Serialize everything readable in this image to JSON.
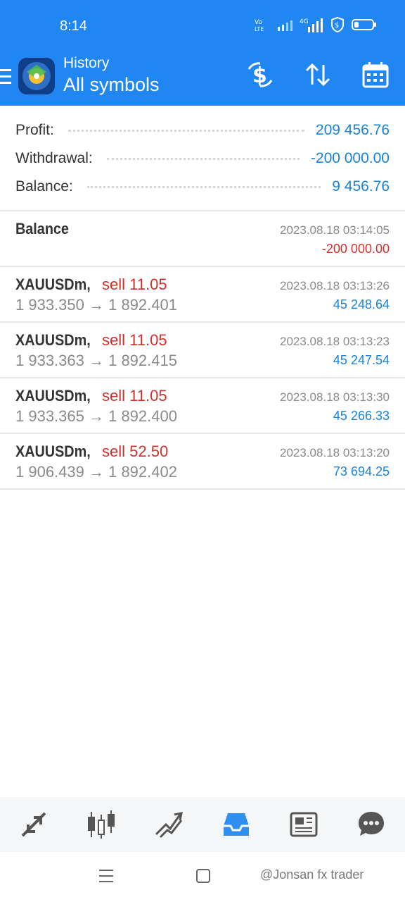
{
  "status_bar": {
    "time": "8:14",
    "battery": 0.25
  },
  "header": {
    "subtitle": "History",
    "title": "All symbols"
  },
  "summary": [
    {
      "label": "Profit:",
      "value": "209 456.76"
    },
    {
      "label": "Withdrawal:",
      "value": "-200 000.00"
    },
    {
      "label": "Balance:",
      "value": "9 456.76"
    }
  ],
  "trades": [
    {
      "title": "Balance",
      "time": "2023.08.18 03:14:05",
      "amount": "-200 000.00",
      "amount_color": "#d0302d"
    },
    {
      "symbol": "XAUUSDm,",
      "action": "sell 11.05",
      "prices": "1 933.350 → 1 892.401",
      "time": "2023.08.18 03:13:26",
      "amount": "45 248.64"
    },
    {
      "symbol": "XAUUSDm,",
      "action": "sell 11.05",
      "prices": "1 933.363 → 1 892.415",
      "time": "2023.08.18 03:13:23",
      "amount": "45 247.54"
    },
    {
      "symbol": "XAUUSDm,",
      "action": "sell 11.05",
      "prices": "1 933.365 → 1 892.400",
      "time": "2023.08.18 03:13:30",
      "amount": "45 266.33"
    },
    {
      "symbol": "XAUUSDm,",
      "action": "sell 52.50",
      "prices": "1 906.439 → 1 892.402",
      "time": "2023.08.18 03:13:20",
      "amount": "73 694.25"
    }
  ],
  "bottom_nav": [
    {
      "icon": "quotes-arrows-icon"
    },
    {
      "icon": "candlestick-chart-icon"
    },
    {
      "icon": "trade-trend-icon"
    },
    {
      "icon": "history-inbox-icon",
      "active": true
    },
    {
      "icon": "news-icon"
    },
    {
      "icon": "chat-icon"
    }
  ],
  "watermark": "@Jonsan fx trader",
  "colors": {
    "accent": "#1f86f2",
    "profit_blue": "#1a82d8",
    "loss_red": "#d0302d"
  }
}
